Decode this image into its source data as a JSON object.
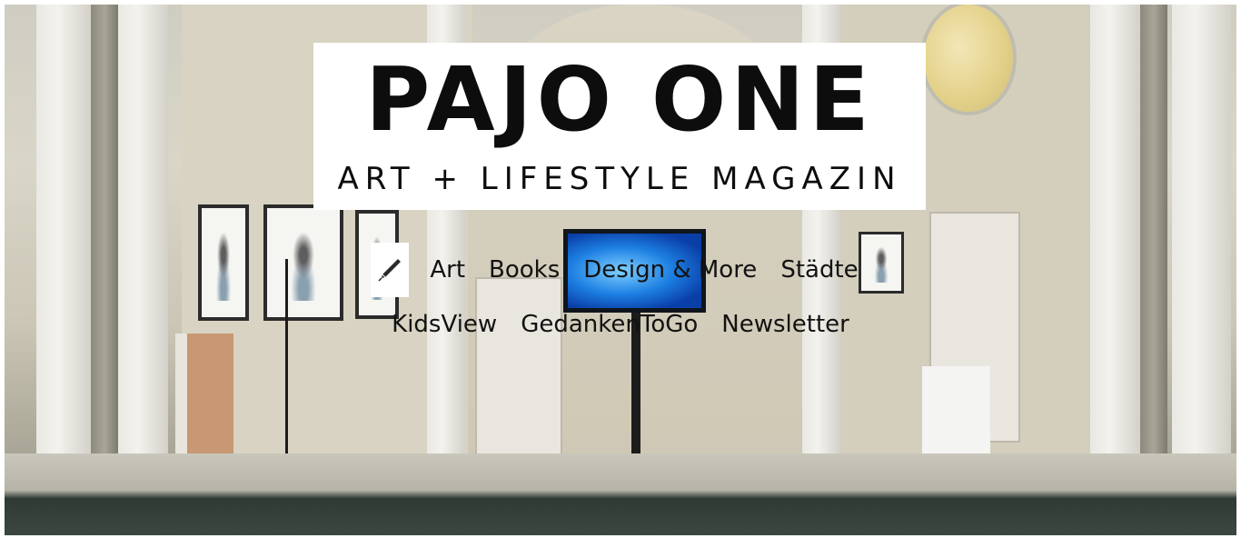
{
  "logo": {
    "title": "PAJO ONE",
    "subtitle": "ART + LIFESTYLE MAGAZIN"
  },
  "nav": {
    "row1": [
      "Art",
      "Books",
      "Design & More",
      "Städte"
    ],
    "row2": [
      "KidsView",
      "GedankenToGo",
      "Newsletter"
    ]
  },
  "icons": {
    "nav_icon": "pen-icon"
  },
  "colors": {
    "text": "#121212",
    "logo_bg": "#ffffff"
  }
}
